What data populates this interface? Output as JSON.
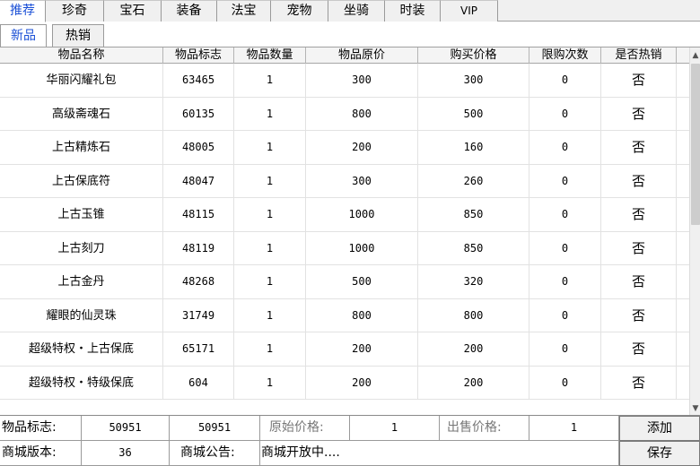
{
  "tabs": [
    "推荐",
    "珍奇",
    "宝石",
    "装备",
    "法宝",
    "宠物",
    "坐骑",
    "时装",
    "VIP"
  ],
  "subtabs": [
    "新品",
    "热销"
  ],
  "table": {
    "columns": [
      "物品名称",
      "物品标志",
      "物品数量",
      "物品原价",
      "购买价格",
      "限购次数",
      "是否热销"
    ],
    "rows": [
      [
        "华丽闪耀礼包",
        "63465",
        "1",
        "300",
        "300",
        "0",
        "否"
      ],
      [
        "高级斋魂石",
        "60135",
        "1",
        "800",
        "500",
        "0",
        "否"
      ],
      [
        "上古精炼石",
        "48005",
        "1",
        "200",
        "160",
        "0",
        "否"
      ],
      [
        "上古保底符",
        "48047",
        "1",
        "300",
        "260",
        "0",
        "否"
      ],
      [
        "上古玉锥",
        "48115",
        "1",
        "1000",
        "850",
        "0",
        "否"
      ],
      [
        "上古刻刀",
        "48119",
        "1",
        "1000",
        "850",
        "0",
        "否"
      ],
      [
        "上古金丹",
        "48268",
        "1",
        "500",
        "320",
        "0",
        "否"
      ],
      [
        "耀眼的仙灵珠",
        "31749",
        "1",
        "800",
        "800",
        "0",
        "否"
      ],
      [
        "超级特权・上古保底",
        "65171",
        "1",
        "200",
        "200",
        "0",
        "否"
      ],
      [
        "超级特权・特级保底",
        "604",
        "1",
        "200",
        "200",
        "0",
        "否"
      ]
    ]
  },
  "form": {
    "item_id_label": "物品标志:",
    "item_id_value1": "50951",
    "item_id_value2": "50951",
    "orig_price_label": "原始价格:",
    "orig_price_value": "1",
    "sell_price_label": "出售价格:",
    "sell_price_value": "1",
    "add_button": "添加",
    "version_label": "商城版本:",
    "version_value": "36",
    "notice_label": "商城公告:",
    "notice_value": "商城开放中....",
    "save_button": "保存"
  },
  "colors": {
    "active_tab_text": "#1a4fd6"
  }
}
